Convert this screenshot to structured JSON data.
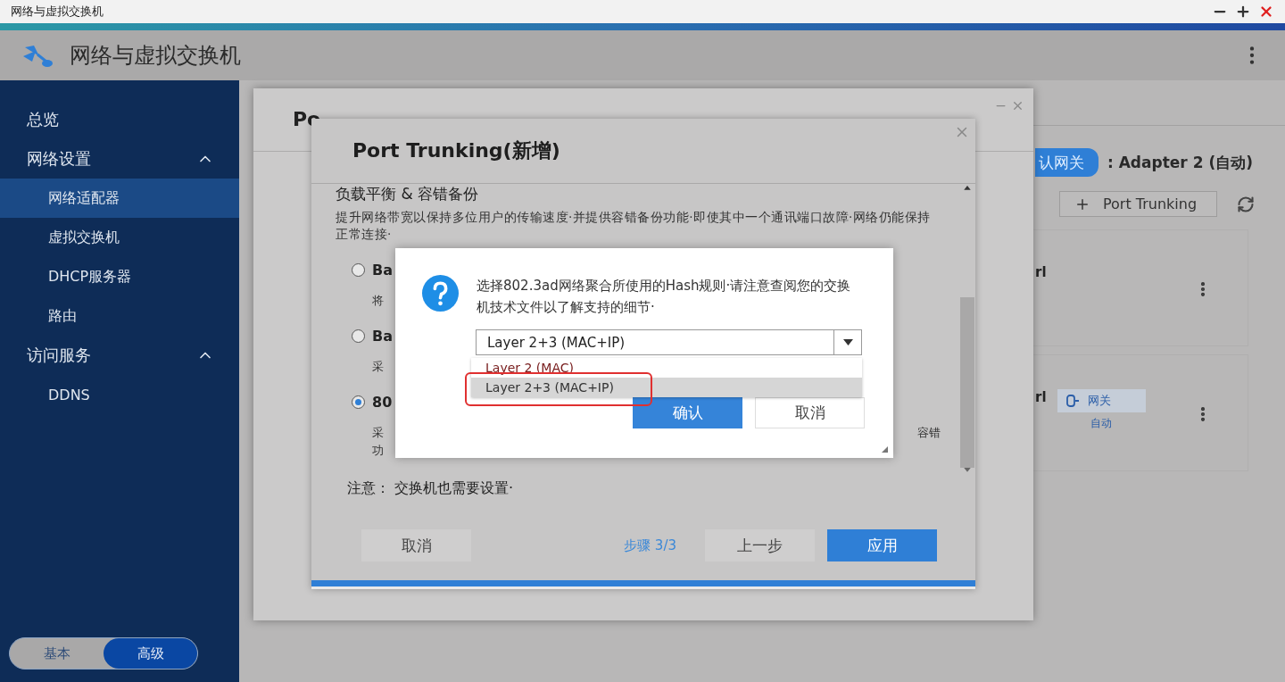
{
  "window": {
    "title": "网络与虚拟交换机"
  },
  "app": {
    "title": "网络与虚拟交换机"
  },
  "sidebar": {
    "items": [
      {
        "label": "总览",
        "kind": "item",
        "selected": false
      },
      {
        "label": "网络设置",
        "kind": "section",
        "expanded": true,
        "children": [
          {
            "label": "网络适配器",
            "selected": true
          },
          {
            "label": "虚拟交换机",
            "selected": false
          },
          {
            "label": "DHCP服务器",
            "selected": false
          },
          {
            "label": "路由",
            "selected": false
          }
        ]
      },
      {
        "label": "访问服务",
        "kind": "section",
        "expanded": true,
        "children": [
          {
            "label": "DDNS",
            "selected": false
          }
        ]
      }
    ],
    "mode_toggle": [
      {
        "label": "基本",
        "selected": false
      },
      {
        "label": "高级",
        "selected": true
      }
    ]
  },
  "content": {
    "gateway_button": "认网关",
    "gateway_value": ": Adapter 2 (自动)",
    "add_button": "Port Trunking",
    "cards": [
      {
        "name": "rl"
      },
      {
        "name": "rl",
        "badge": "网关",
        "badge_status": "自动"
      }
    ]
  },
  "back_dialog": {
    "title": "Po"
  },
  "dialog": {
    "title": "Port Trunking(新增)",
    "heading": "负载平衡 & 容错备份",
    "description": "提升网络带宽以保持多位用户的传输速度·并提供容错备份功能·即使其中一个通讯端口故障·网络仍能保持正常连接·",
    "options": [
      {
        "label": "Ba",
        "description": [
          "将"
        ],
        "selected": false
      },
      {
        "label": "Ba",
        "description": [
          "采"
        ],
        "selected": false
      },
      {
        "label": "80",
        "description": [
          "采",
          "功"
        ],
        "tail": "容错",
        "selected": true
      }
    ],
    "note": "注意： 交换机也需要设置·",
    "cancel": "取消",
    "step": "步骤 3/3",
    "back": "上一步",
    "apply": "应用"
  },
  "message": {
    "text": "选择802.3ad网络聚合所使用的Hash规则·请注意查阅您的交换机技术文件以了解支持的细节·",
    "select_value": "Layer 2+3 (MAC+IP)",
    "options": [
      {
        "label": "Layer 2 (MAC)",
        "selected": false
      },
      {
        "label": "Layer 2+3 (MAC+IP)",
        "selected": true
      }
    ],
    "confirm": "确认",
    "cancel": "取消"
  }
}
